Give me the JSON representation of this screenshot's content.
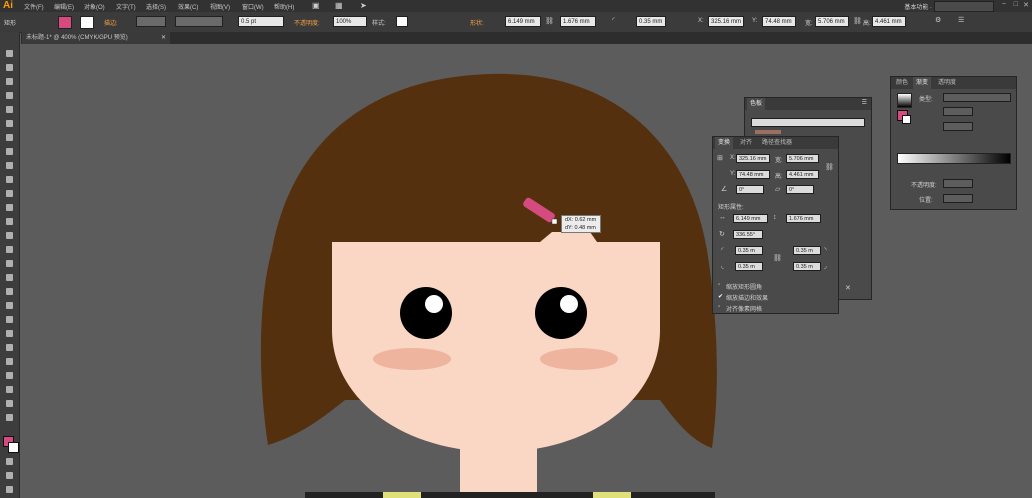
{
  "menubar": {
    "logo": "Ai",
    "items": [
      "文件(F)",
      "编辑(E)",
      "对象(O)",
      "文字(T)",
      "选择(S)",
      "效果(C)",
      "视图(V)",
      "窗口(W)",
      "帮助(H)"
    ],
    "workspace": "基本功能 ·",
    "window_controls": [
      "−",
      "□",
      "✕"
    ]
  },
  "controlbar": {
    "selection_label": "矩形",
    "stroke_label": "描边:",
    "stroke_weight": "0.5 pt",
    "opacity_label": "不透明度:",
    "opacity_value": "100%",
    "style_label": "样式:",
    "shape_label": "形状:",
    "w_value": "6.149 mm",
    "h_value": "1.676 mm",
    "corner_value": "0.35 mm",
    "x_value": "325.16 mm",
    "y_value": "74.48 mm",
    "w2_value": "5.706 mm",
    "h2_value": "4.461 mm",
    "colors": {
      "fill": "#d64b7f",
      "hair": "#55300f",
      "skin": "#fad6c4",
      "blush": "#eeb49e"
    }
  },
  "document_tab": {
    "label": "未标题-1* @ 400% (CMYK/GPU 预览)",
    "close": "✕"
  },
  "tooltip": {
    "dx": "dX: 0.62 mm",
    "dy": "dY: 0.48 mm"
  },
  "swatches_panel": {
    "title": "色板"
  },
  "transform_panel": {
    "tabs": [
      "变换",
      "对齐",
      "路径查找器"
    ],
    "x_label": "X:",
    "x_value": "325.16 mm",
    "w_label": "宽:",
    "w_value": "5.706 mm",
    "y_label": "Y:",
    "y_value": "74.48 mm",
    "h_label": "高:",
    "h_value": "4.461 mm",
    "angle_value": "0°",
    "shear_value": "0°",
    "rect_props_label": "矩形属性:",
    "rect_w_value": "6.149 mm",
    "rect_h_value": "1.676 mm",
    "rect_angle_value": "336.55°",
    "corner_tl": "0.35 m",
    "corner_tr": "0.35 m",
    "corner_bl": "0.35 m",
    "corner_br": "0.35 m",
    "opt_scale_corners": "缩放矩形圆角",
    "opt_scale_strokes": "缩放描边和效果",
    "opt_align_pixel": "对齐像素网格",
    "opt_scale_strokes_checked": true
  },
  "gradient_panel": {
    "tabs": [
      "颜色",
      "渐变",
      "透明度"
    ],
    "type_label": "类型:",
    "opacity_label": "不透明度:",
    "location_label": "位置:"
  }
}
